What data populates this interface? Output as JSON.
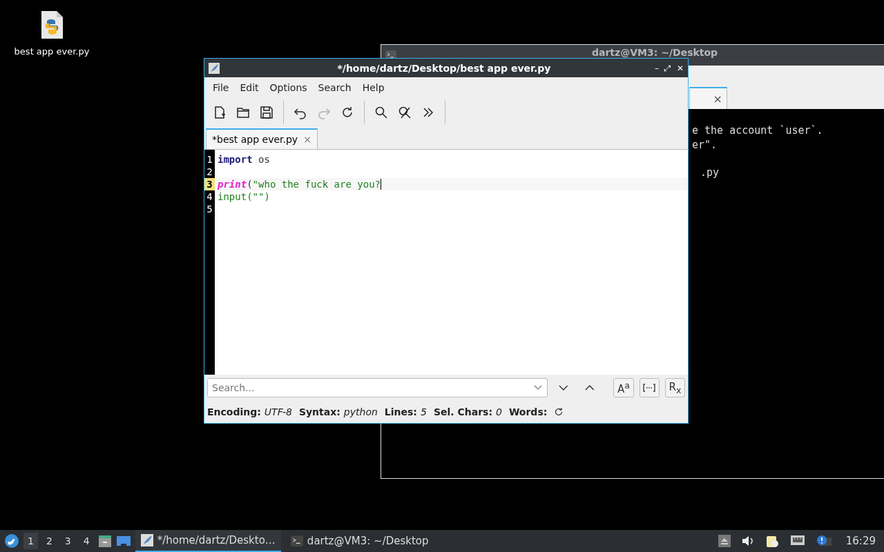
{
  "desktop_icons": [
    {
      "label": "best app ever.py"
    }
  ],
  "terminal": {
    "title": "dartz@VM3: ~/Desktop",
    "tab_close": "×",
    "lines": [
      {
        "text": "e the account `user`."
      },
      {
        "text": "er\"."
      },
      {
        "text": ".py"
      }
    ]
  },
  "editor": {
    "title": "*/home/dartz/Desktop/best app ever.py",
    "window_buttons": [
      "–",
      "⤢",
      "✕"
    ],
    "menu": [
      "File",
      "Edit",
      "Options",
      "Search",
      "Help"
    ],
    "toolbar": [
      {
        "kind": "new",
        "disabled": false
      },
      {
        "kind": "open",
        "disabled": false
      },
      {
        "kind": "save",
        "disabled": false
      },
      {
        "kind": "sep"
      },
      {
        "kind": "undo",
        "disabled": false
      },
      {
        "kind": "redo",
        "disabled": true
      },
      {
        "kind": "reload",
        "disabled": false
      },
      {
        "kind": "sep"
      },
      {
        "kind": "find",
        "disabled": false
      },
      {
        "kind": "clear",
        "disabled": false
      },
      {
        "kind": "more",
        "disabled": false
      },
      {
        "kind": "sep"
      }
    ],
    "tabs": [
      {
        "label": "*best app ever.py",
        "close": "×",
        "selected": true
      }
    ],
    "lines": [
      {
        "number": "1",
        "current": false,
        "tokens": [
          {
            "kind": "keyword",
            "text": "import"
          },
          {
            "kind": "plain",
            "text": " os"
          }
        ]
      },
      {
        "number": "2",
        "current": false
      },
      {
        "number": "3",
        "current": true,
        "tokens": [
          {
            "kind": "builtin",
            "text": "print"
          },
          {
            "kind": "plain",
            "text": "("
          },
          {
            "kind": "string",
            "text": "\"who the fuck are you?"
          }
        ]
      },
      {
        "number": "4",
        "current": false,
        "tokens": [
          {
            "kind": "string",
            "text": "input(\"\")"
          }
        ]
      },
      {
        "number": "5",
        "current": false
      }
    ],
    "search": {
      "placeholder": "Search...",
      "case_label": "A$^{a}$",
      "regex_label": "R$_{x}$"
    },
    "status": [
      {
        "label": "Encoding:",
        "value": "UTF-8"
      },
      {
        "label": "Syntax:",
        "value": "python"
      },
      {
        "label": "Lines:",
        "value": "5"
      },
      {
        "label": "Sel. Chars:",
        "value": "0"
      },
      {
        "label": "Words:"
      }
    ]
  },
  "taskbar": {
    "workspaces": [
      {
        "label": "1",
        "selected": true
      },
      {
        "label": "2",
        "selected": false
      },
      {
        "label": "3",
        "selected": false
      },
      {
        "label": "4",
        "selected": false
      }
    ],
    "tasks": [
      {
        "kind": "editor",
        "label": "*/home/dartz/Deskto…",
        "selected": true
      },
      {
        "kind": "terminal",
        "label": "dartz@VM3: ~/Desktop",
        "selected": false
      }
    ],
    "clock": "16:29"
  }
}
